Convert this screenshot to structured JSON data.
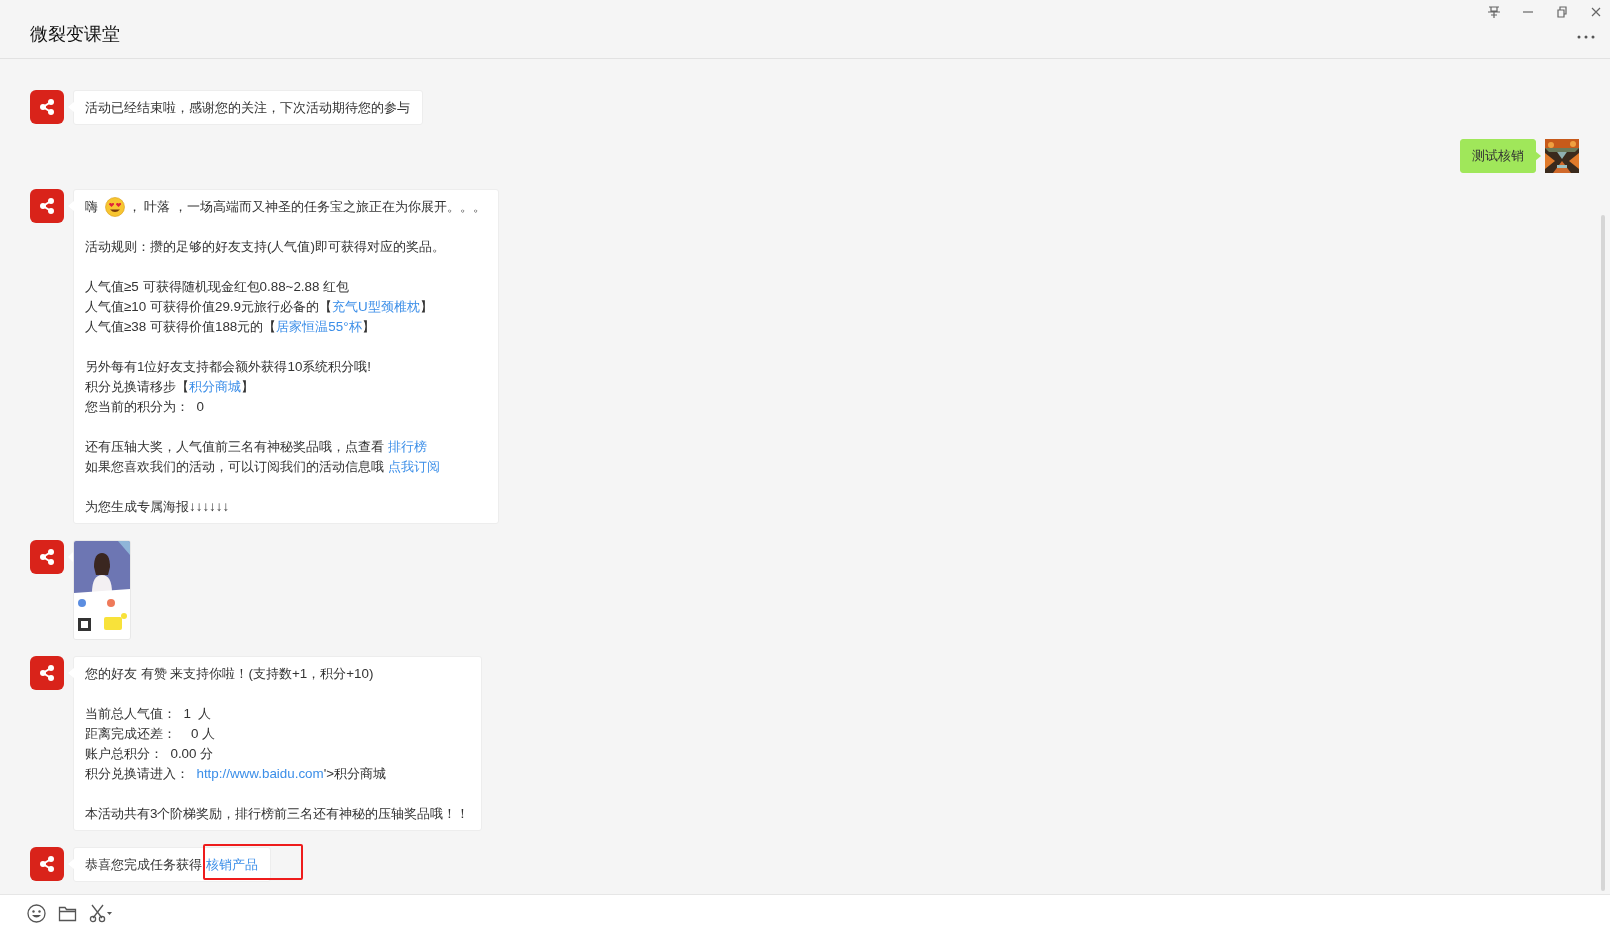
{
  "window": {
    "title": "微裂变课堂"
  },
  "messages": [
    {
      "kind": "incoming",
      "paragraphs": [
        [
          [
            {
              "kind": "text",
              "text": "活动已经结束啦，感谢您的关注，下次活动期待您的参与"
            }
          ]
        ]
      ]
    },
    {
      "kind": "outgoing",
      "paragraphs": [
        [
          [
            {
              "kind": "text",
              "text": "测试核销"
            }
          ]
        ]
      ]
    },
    {
      "kind": "incoming",
      "paragraphs": [
        [
          [
            {
              "kind": "text",
              "text": "嗨 "
            },
            {
              "kind": "emoji"
            },
            {
              "kind": "text",
              "text": "， 叶落 ，一场高端而又神圣的任务宝之旅正在为你展开。。。"
            }
          ]
        ],
        [
          [
            {
              "kind": "text",
              "text": "活动规则：攒的足够的好友支持(人气值)即可获得对应的奖品。"
            }
          ]
        ],
        [
          [
            {
              "kind": "text",
              "text": "人气值≥5 可获得随机现金红包0.88~2.88 红包"
            }
          ],
          [
            {
              "kind": "text",
              "text": "人气值≥10 可获得价值29.9元旅行必备的【"
            },
            {
              "kind": "link",
              "text": "充气U型颈椎枕"
            },
            {
              "kind": "text",
              "text": "】"
            }
          ],
          [
            {
              "kind": "text",
              "text": "人气值≥38 可获得价值188元的【"
            },
            {
              "kind": "link",
              "text": "居家恒温55°杯"
            },
            {
              "kind": "text",
              "text": "】"
            }
          ]
        ],
        [
          [
            {
              "kind": "text",
              "text": "另外每有1位好友支持都会额外获得10系统积分哦!"
            }
          ],
          [
            {
              "kind": "text",
              "text": "积分兑换请移步【"
            },
            {
              "kind": "link",
              "text": "积分商城"
            },
            {
              "kind": "text",
              "text": "】"
            }
          ],
          [
            {
              "kind": "text",
              "text": "您当前的积分为：  0"
            }
          ]
        ],
        [
          [
            {
              "kind": "text",
              "text": "还有压轴大奖，人气值前三名有神秘奖品哦，点查看 "
            },
            {
              "kind": "link",
              "text": "排行榜"
            }
          ],
          [
            {
              "kind": "text",
              "text": "如果您喜欢我们的活动，可以订阅我们的活动信息哦 "
            },
            {
              "kind": "link",
              "text": "点我订阅"
            }
          ]
        ],
        [
          [
            {
              "kind": "text",
              "text": "为您生成专属海报↓↓↓↓↓↓"
            }
          ]
        ]
      ]
    },
    {
      "picture": {
        "kind": "picture"
      }
    },
    {
      "kind": "incoming",
      "paragraphs": [
        [
          [
            {
              "kind": "text",
              "text": "您的好友 有赞 来支持你啦！(支持数+1，积分+10)"
            }
          ]
        ],
        [
          [
            {
              "kind": "text",
              "text": "当前总人气值：  1  人"
            }
          ],
          [
            {
              "kind": "text",
              "text": "距离完成还差：    0 人"
            }
          ],
          [
            {
              "kind": "text",
              "text": "账户总积分：  0.00 分"
            }
          ],
          [
            {
              "kind": "text",
              "text": "积分兑换请进入：  "
            },
            {
              "kind": "link",
              "text": "http://www.baidu.com"
            },
            {
              "kind": "text",
              "text": "'>积分商城"
            }
          ]
        ],
        [
          [
            {
              "kind": "text",
              "text": "本活动共有3个阶梯奖励，排行榜前三名还有神秘的压轴奖品哦！！"
            }
          ]
        ]
      ]
    },
    {
      "kind": "incoming",
      "paragraphs": [
        [
          [
            {
              "kind": "text",
              "text": "恭喜您完成任务获得 "
            },
            {
              "kind": "link",
              "text": "核销产品",
              "highlighted": true
            }
          ]
        ]
      ]
    }
  ]
}
